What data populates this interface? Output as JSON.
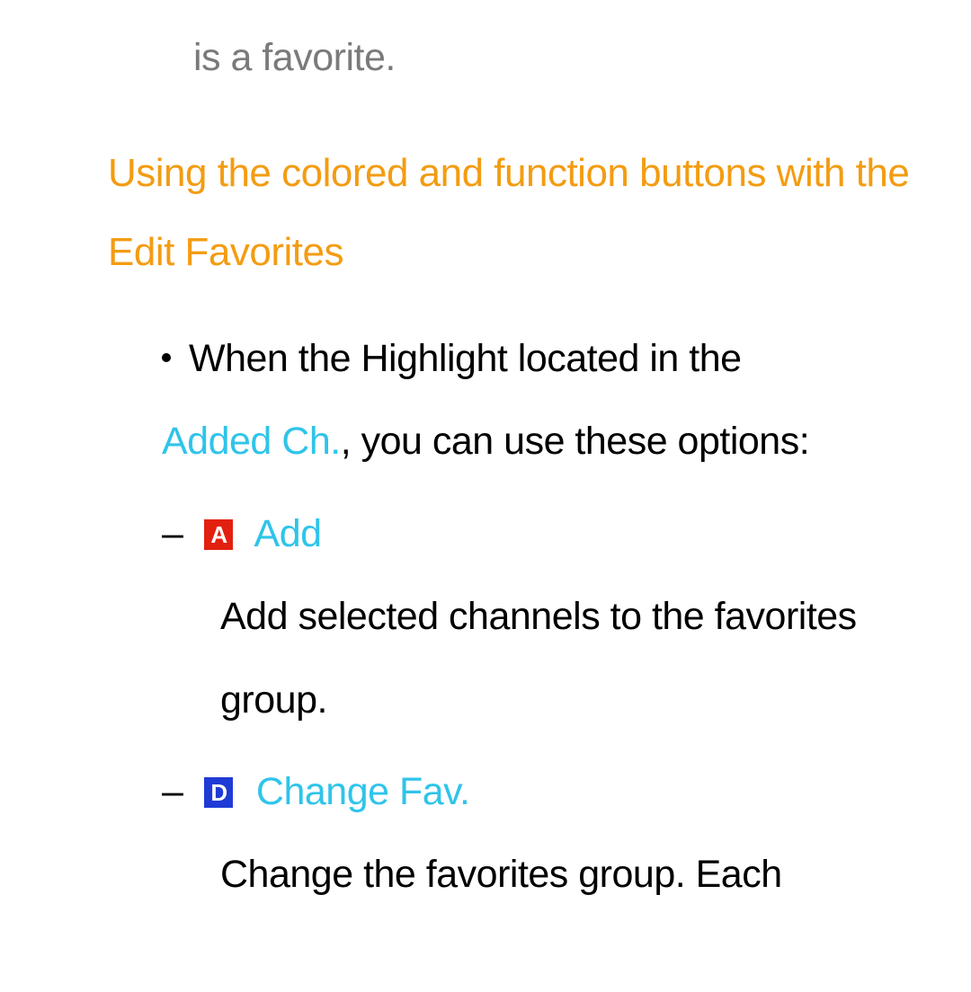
{
  "fragment_top": "is a favorite.",
  "heading": "Using the colored and function buttons with the Edit Favorites",
  "bullet": {
    "lead": "When the Highlight located in the ",
    "link": "Added Ch.",
    "tail": ", you can use these options:"
  },
  "items": [
    {
      "badge_letter": "A",
      "badge_class": "badge-a",
      "title": "Add",
      "desc": "Add selected channels to the favorites group."
    },
    {
      "badge_letter": "D",
      "badge_class": "badge-d",
      "title": "Change Fav.",
      "desc": "Change the favorites group. Each"
    }
  ]
}
